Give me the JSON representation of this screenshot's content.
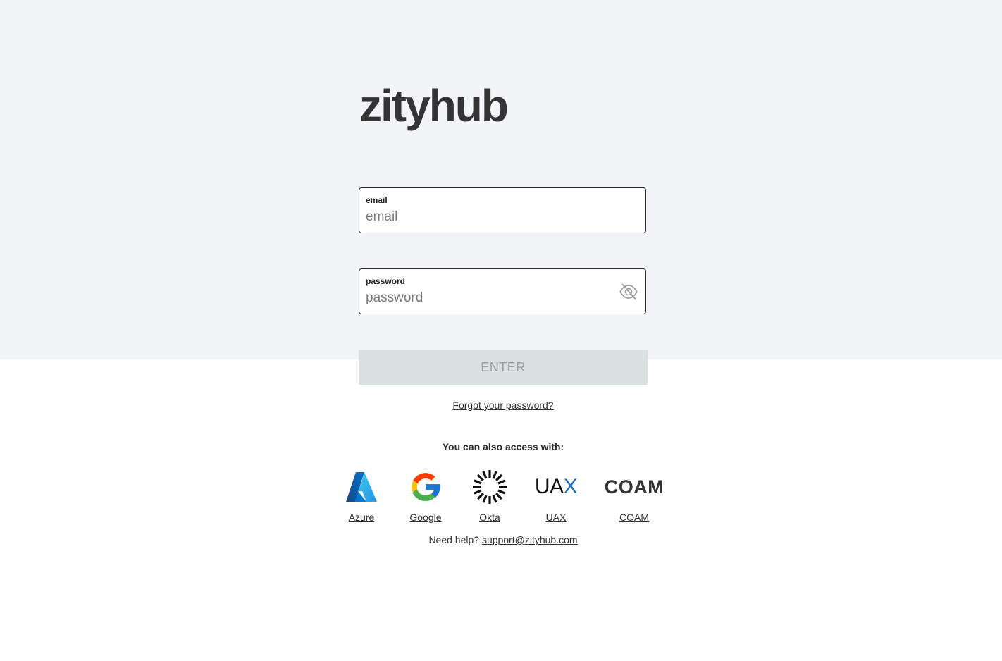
{
  "brand": {
    "name": "zityhub"
  },
  "login_form": {
    "email": {
      "label": "email",
      "value": "",
      "placeholder": "email"
    },
    "password": {
      "label": "password",
      "value": "",
      "placeholder": "password",
      "toggle_icon": "eye-slash-icon"
    },
    "enter_label": "ENTER",
    "forgot_label": "Forgot your password?"
  },
  "sso": {
    "heading": "You can also access with:",
    "providers": [
      {
        "label": "Azure",
        "icon": "azure-icon"
      },
      {
        "label": "Google",
        "icon": "google-icon"
      },
      {
        "label": "Okta",
        "icon": "okta-icon"
      },
      {
        "label": "UAX",
        "icon": "uax-icon",
        "logo_text_main": "UA",
        "logo_text_accent": "X"
      },
      {
        "label": "COAM",
        "icon": "coam-icon",
        "logo_text": "COAM"
      }
    ]
  },
  "help": {
    "prefix": "Need help?",
    "email": "support@zityhub.com"
  },
  "colors": {
    "top_band": "#f3f4f7",
    "enter_button_bg": "#dadfe0",
    "enter_button_text": "#9aa0a2",
    "uax_accent": "#1c6fbf"
  }
}
